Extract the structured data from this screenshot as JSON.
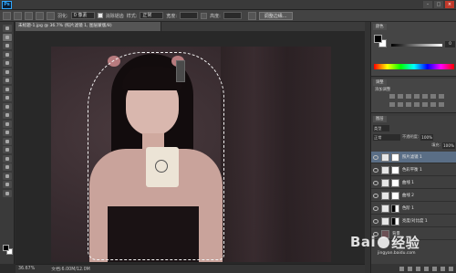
{
  "menu": {
    "logo": "Ps",
    "items": [
      "",
      "",
      "",
      "",
      "",
      "",
      "",
      "",
      "",
      ""
    ]
  },
  "window": {
    "min": "–",
    "max": "□",
    "close": "×"
  },
  "options": {
    "feather_label": "羽化:",
    "feather_value": "0 像素",
    "antialias_label": "消除锯齿",
    "style_label": "样式:",
    "style_value": "正常",
    "width_label": "宽度:",
    "height_label": "高度:",
    "refine_button": "调整边缘..."
  },
  "document": {
    "tab_title": "未标题-1.jpg @ 36.7% (照片滤镜 1, 图层蒙版/8)"
  },
  "color_panel": {
    "tab": "颜色",
    "value": "0",
    "fg": "#000000",
    "bg": "#ffffff"
  },
  "adjustments_panel": {
    "tab": "调整",
    "label": "添加调整"
  },
  "layers_panel": {
    "tab": "图层",
    "kind": "类型",
    "blend_mode": "正常",
    "opacity_label": "不透明度:",
    "opacity": "100%",
    "fill_label": "填充:",
    "fill": "100%",
    "layers": [
      {
        "name": "照片滤镜 1",
        "selected": true,
        "thumb": "adj",
        "mask": "light"
      },
      {
        "name": "色彩平衡 1",
        "selected": false,
        "thumb": "adj",
        "mask": "light"
      },
      {
        "name": "曲线 1",
        "selected": false,
        "thumb": "adj",
        "mask": "light"
      },
      {
        "name": "曲线 2",
        "selected": false,
        "thumb": "adj",
        "mask": "light"
      },
      {
        "name": "色阶 1",
        "selected": false,
        "thumb": "adj",
        "mask": "dark"
      },
      {
        "name": "亮度/对比度 1",
        "selected": false,
        "thumb": "adj",
        "mask": "dark"
      },
      {
        "name": "背景",
        "selected": false,
        "thumb": "photo",
        "mask": "none"
      }
    ]
  },
  "status": {
    "zoom": "36.67%",
    "doc_size": "文档:6.00M/12.0M"
  },
  "watermark": {
    "text_left": "Bai",
    "text_right": "经验",
    "sub": "jingyan.baidu.com"
  }
}
